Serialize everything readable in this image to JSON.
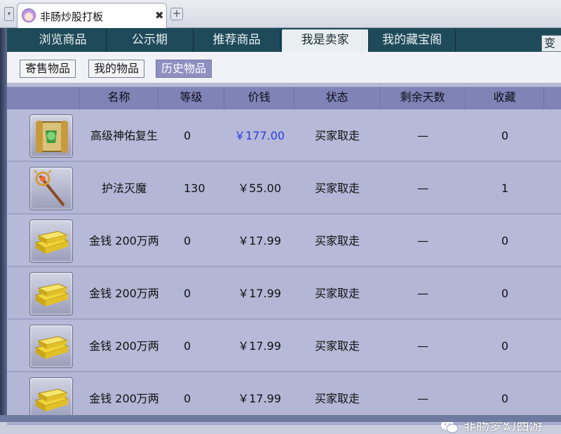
{
  "browser": {
    "tab_title": "非肠炒股打板",
    "close_glyph": "✖",
    "new_tab_glyph": "+",
    "menu_glyph": "▾"
  },
  "nav": {
    "tabs": [
      "浏览商品",
      "公示期",
      "推荐商品",
      "我是卖家",
      "我的藏宝阁"
    ],
    "active_index": 3,
    "right_label": "变"
  },
  "subnav": {
    "buttons": [
      "寄售物品",
      "我的物品",
      "历史物品"
    ],
    "active_index": 2
  },
  "table": {
    "headers": [
      "名称",
      "等级",
      "价钱",
      "状态",
      "剩余天数",
      "收藏"
    ],
    "rows": [
      {
        "icon": "scroll-icon",
        "name": "高级神佑复生",
        "level": "0",
        "price": "￥177.00",
        "status": "买家取走",
        "days": "—",
        "fav": "0",
        "price_highlight": true
      },
      {
        "icon": "staff-icon",
        "name": "护法灭魔",
        "level": "130",
        "price": "￥55.00",
        "status": "买家取走",
        "days": "—",
        "fav": "1",
        "price_highlight": false
      },
      {
        "icon": "gold-bars-icon",
        "name": "金钱 200万两",
        "level": "0",
        "price": "￥17.99",
        "status": "买家取走",
        "days": "—",
        "fav": "0",
        "price_highlight": false
      },
      {
        "icon": "gold-bars-icon",
        "name": "金钱 200万两",
        "level": "0",
        "price": "￥17.99",
        "status": "买家取走",
        "days": "—",
        "fav": "0",
        "price_highlight": false
      },
      {
        "icon": "gold-bars-icon",
        "name": "金钱 200万两",
        "level": "0",
        "price": "￥17.99",
        "status": "买家取走",
        "days": "—",
        "fav": "0",
        "price_highlight": false
      },
      {
        "icon": "gold-bars-icon",
        "name": "金钱 200万两",
        "level": "0",
        "price": "￥17.99",
        "status": "买家取走",
        "days": "—",
        "fav": "0",
        "price_highlight": false
      }
    ]
  },
  "watermark": "非肠梦幻西游",
  "colors": {
    "nav_bg": "#1f4a5a",
    "header_bg": "#7f83b6",
    "row_bg": "#b3b6d5",
    "price_highlight": "#2c3be0"
  }
}
